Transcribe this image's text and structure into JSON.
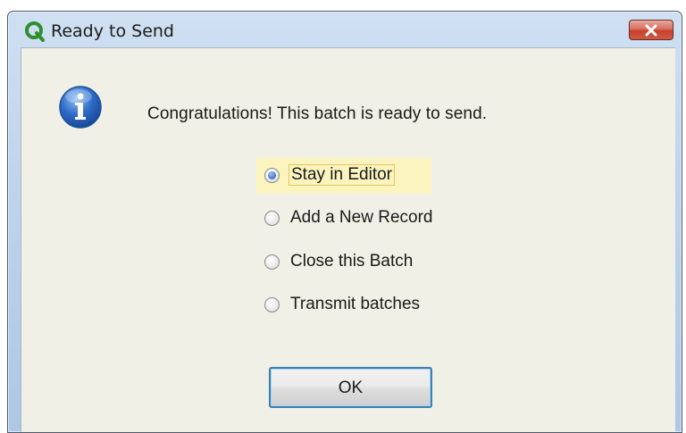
{
  "window": {
    "title": "Ready to Send",
    "app_icon": "q-logo-icon",
    "close_icon": "close-icon"
  },
  "dialog": {
    "icon": "info-icon",
    "message": "Congratulations!  This batch is ready to send.",
    "options": [
      {
        "label": "Stay in Editor",
        "selected": true
      },
      {
        "label": "Add a New Record",
        "selected": false
      },
      {
        "label": "Close this Batch",
        "selected": false
      },
      {
        "label": "Transmit batches",
        "selected": false
      }
    ],
    "ok_label": "OK"
  },
  "colors": {
    "client_background": "#f0f0e6",
    "focus_highlight": "#fbf4bf",
    "close_button": "#c7412d",
    "info_icon": "#2e6cc7"
  }
}
